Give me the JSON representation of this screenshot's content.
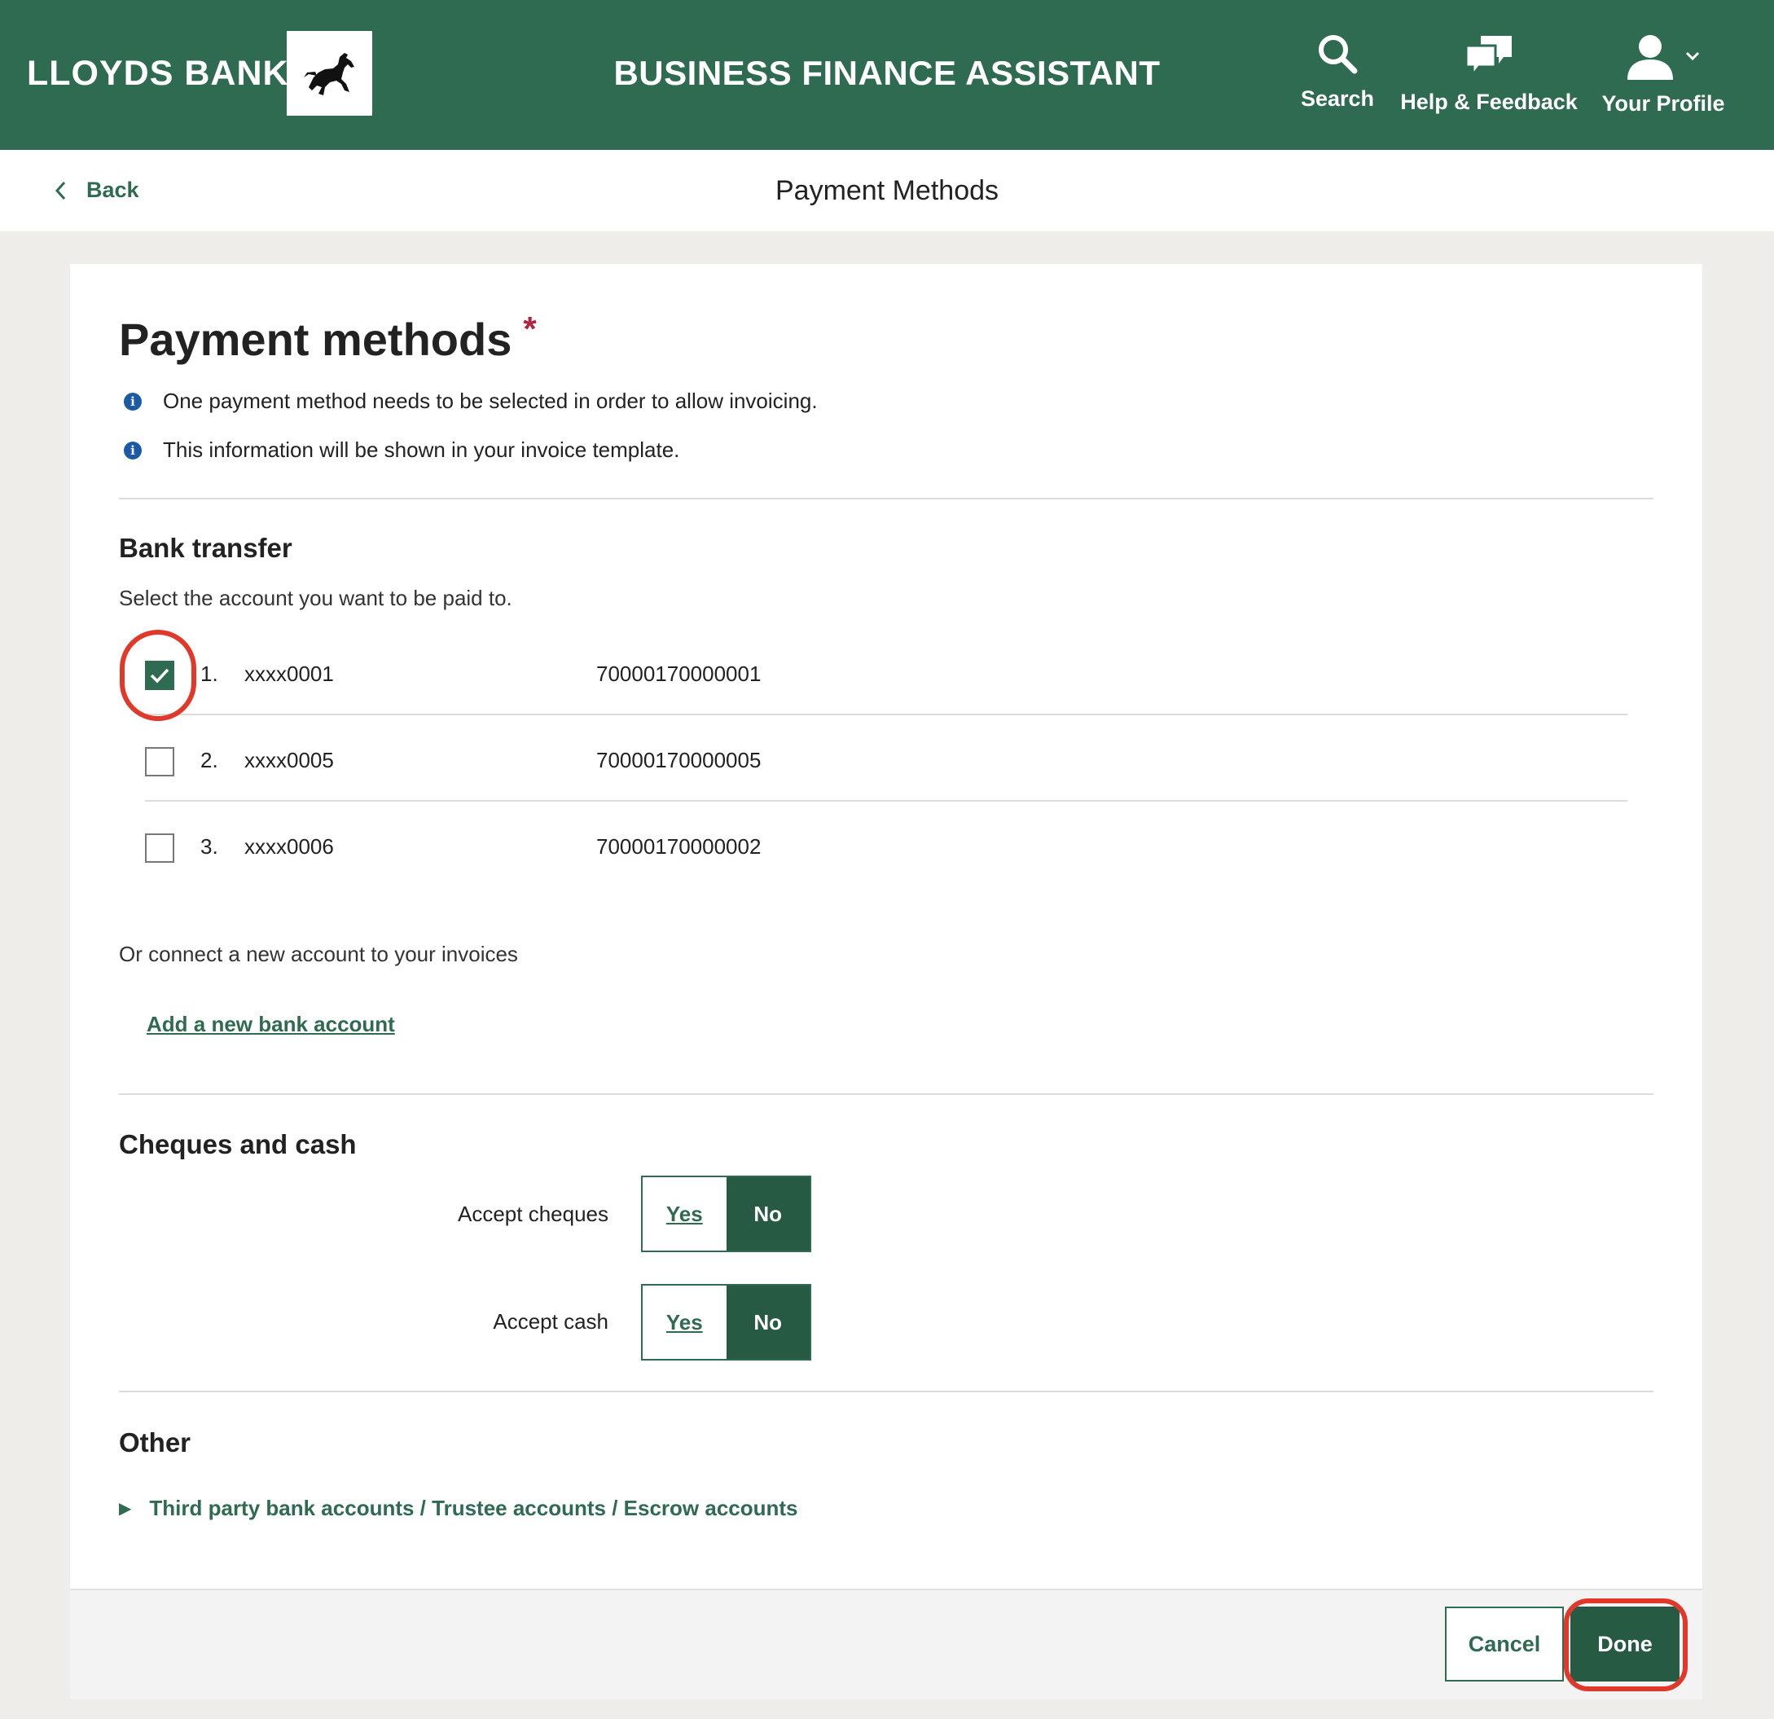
{
  "header": {
    "brand": "LLOYDS BANK",
    "app_title": "BUSINESS FINANCE ASSISTANT",
    "nav": {
      "search": "Search",
      "help": "Help & Feedback",
      "profile": "Your Profile"
    },
    "icons": [
      "horse-logo-icon",
      "search-icon",
      "chat-bubbles-icon",
      "user-icon",
      "chevron-down-icon"
    ],
    "bg_color": "#2e6b50"
  },
  "subheader": {
    "back_label": "Back",
    "page_title": "Payment Methods"
  },
  "main": {
    "heading": "Payment methods",
    "required_mark": "*",
    "info": [
      "One payment method needs to be selected in order to allow invoicing.",
      "This information will be shown in your invoice template."
    ],
    "bank_transfer": {
      "title": "Bank transfer",
      "subtitle": "Select the account you want to be paid to.",
      "accounts": [
        {
          "number": "1.",
          "mask": "xxxx0001",
          "id": "70000170000001",
          "checked": true
        },
        {
          "number": "2.",
          "mask": "xxxx0005",
          "id": "70000170000005",
          "checked": false
        },
        {
          "number": "3.",
          "mask": "xxxx0006",
          "id": "70000170000002",
          "checked": false
        }
      ],
      "connect_text": "Or connect a new account to your invoices",
      "add_link": "Add a new bank account"
    },
    "cheques_cash": {
      "title": "Cheques and cash",
      "cheques_label": "Accept cheques",
      "cash_label": "Accept cash",
      "yes": "Yes",
      "no": "No",
      "cheques_selected": "No",
      "cash_selected": "No"
    },
    "other": {
      "title": "Other",
      "disclosure": "Third party bank accounts / Trustee accounts / Escrow accounts"
    }
  },
  "footer": {
    "cancel": "Cancel",
    "done": "Done"
  },
  "colors": {
    "brand_green": "#2e6b50",
    "dark_green": "#265a43",
    "highlight_red": "#e0392b",
    "required_red": "#b0253e"
  }
}
